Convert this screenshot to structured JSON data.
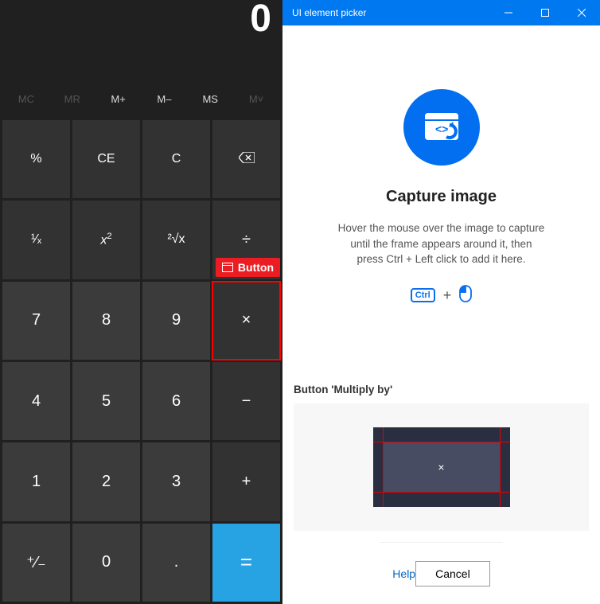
{
  "calc": {
    "display": "0",
    "memory": {
      "mc": "MC",
      "mr": "MR",
      "mplus": "M+",
      "mminus": "M–",
      "ms": "MS",
      "mlist": "M˅"
    },
    "buttons": {
      "percent": "%",
      "ce": "CE",
      "c": "C",
      "recip": "¹⁄ₓ",
      "sq": "x²",
      "sqrt": "²√x",
      "div": "÷",
      "n7": "7",
      "n8": "8",
      "n9": "9",
      "mul": "×",
      "n4": "4",
      "n5": "5",
      "n6": "6",
      "sub": "−",
      "n1": "1",
      "n2": "2",
      "n3": "3",
      "add": "+",
      "neg": "⁺⁄₋",
      "n0": "0",
      "dot": ".",
      "eq": "="
    },
    "highlight_label": "Button"
  },
  "picker": {
    "title": "UI element picker",
    "heading": "Capture image",
    "desc_line1": "Hover the mouse over the image to capture",
    "desc_line2": "until the frame appears around it, then",
    "desc_line3": "press Ctrl + Left click to add it here.",
    "ctrl": "Ctrl",
    "plus": "+",
    "captured_label": "Button 'Multiply by'",
    "thumb_symbol": "×",
    "help": "Help",
    "cancel": "Cancel"
  }
}
